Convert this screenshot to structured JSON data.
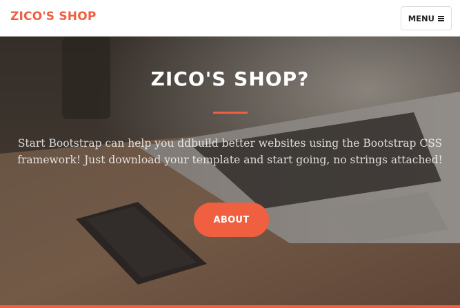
{
  "navbar": {
    "brand": "ZICO'S SHOP",
    "menu_label": "MENU",
    "menu_icon": "bars-icon"
  },
  "hero": {
    "title": "ZICO'S SHOP?",
    "text": "Start Bootstrap can help you ddbuild better websites using the Bootstrap CSS framework! Just download your template and start going, no strings attached!",
    "button_label": "ABOUT",
    "background_image": "laptop-and-phone-on-desk-photo"
  },
  "colors": {
    "accent": "#f05f40",
    "navbar_bg": "#ffffff",
    "hero_text": "#ffffff"
  }
}
